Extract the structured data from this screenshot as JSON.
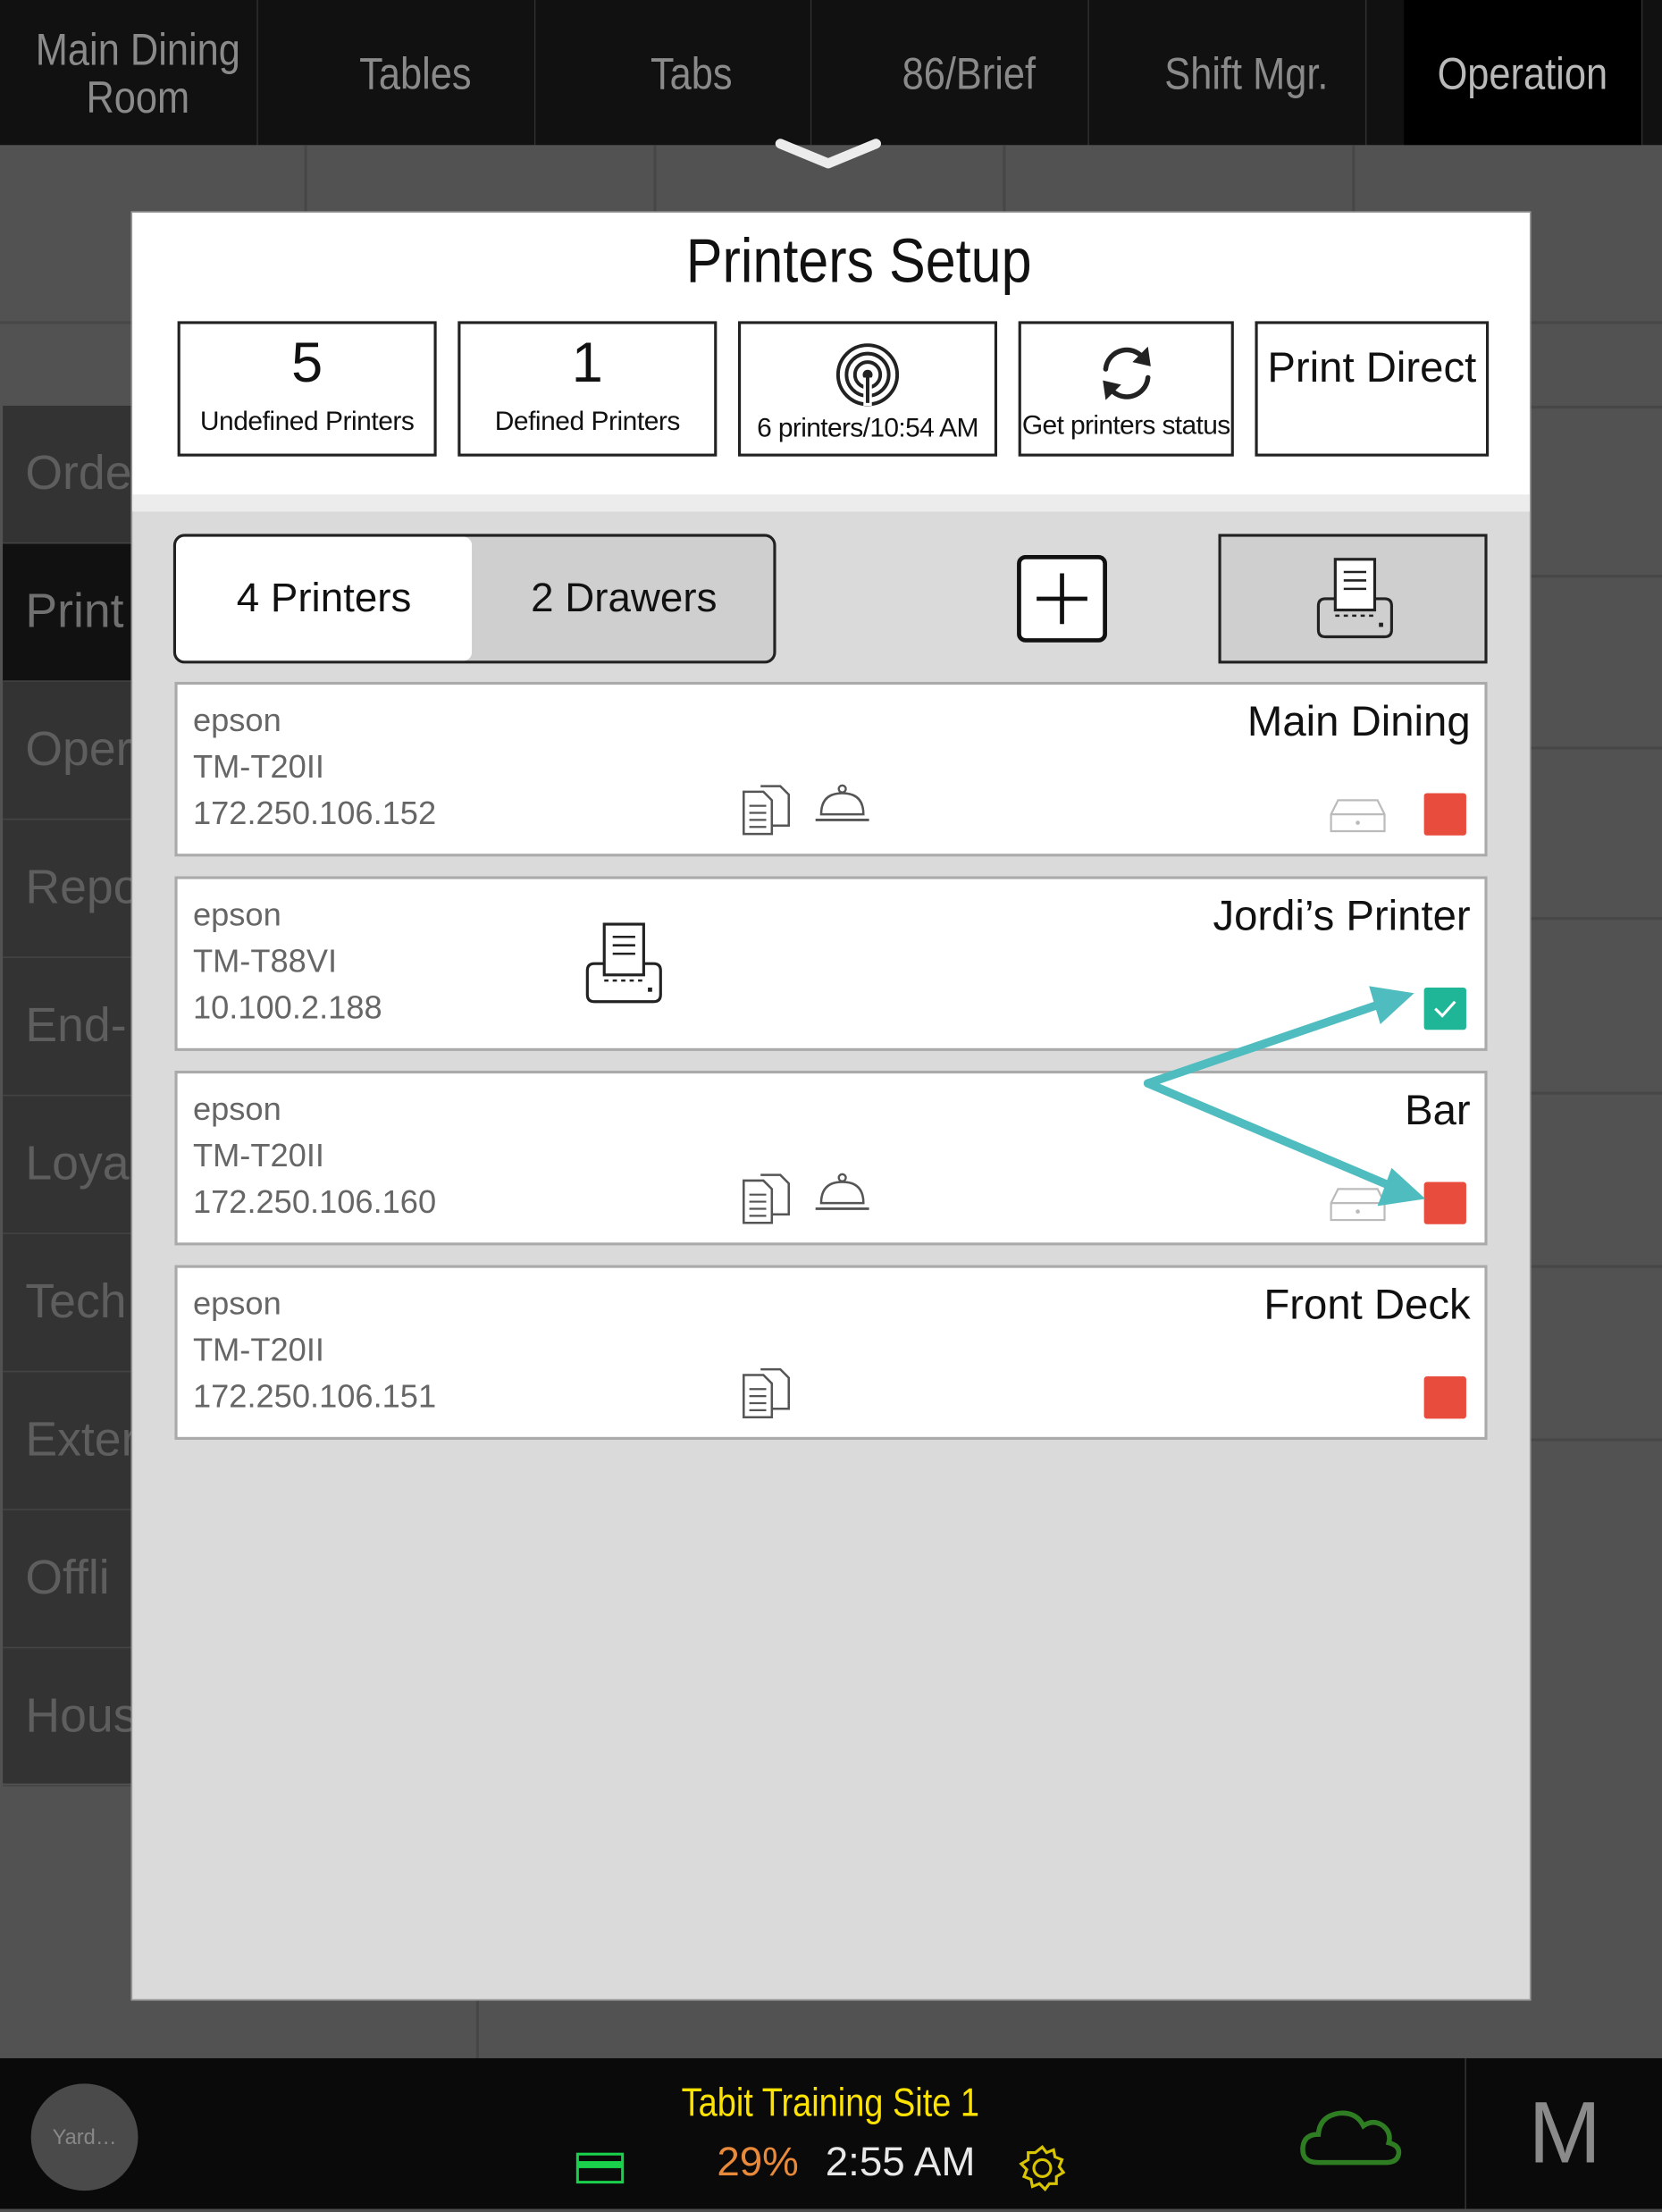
{
  "topnav": {
    "tabs": [
      {
        "label": "Main Dining Room"
      },
      {
        "label": "Tables"
      },
      {
        "label": "Tabs"
      },
      {
        "label": "86/Brief"
      },
      {
        "label": "Shift Mgr."
      },
      {
        "label": "Operation"
      }
    ],
    "active_tab": "Operation"
  },
  "sidemenu": {
    "items": [
      "Orde",
      "Print",
      "Oper",
      "Repo",
      "End-",
      "Loya",
      "Tech",
      "Exter",
      "Offli",
      "Hous"
    ],
    "active_item": "Print"
  },
  "modal": {
    "title": "Printers Setup",
    "stats": {
      "undefined_count": "5",
      "undefined_label": "Undefined Printers",
      "defined_count": "1",
      "defined_label": "Defined Printers",
      "scan_label": "6 printers/10:54 AM",
      "status_label": "Get printers status",
      "print_direct_label": "Print Direct"
    },
    "segment": {
      "printers_label": "4 Printers",
      "drawers_label": "2 Drawers",
      "selected": "4 Printers"
    },
    "printers": [
      {
        "brand": "epson",
        "model": "TM-T20II",
        "ip": "172.250.106.152",
        "name": "Main Dining",
        "status": "off",
        "icons": [
          "document-icon",
          "bell-icon",
          "drawer-icon"
        ]
      },
      {
        "brand": "epson",
        "model": "TM-T88VI",
        "ip": "10.100.2.188",
        "name": "Jordi’s Printer",
        "status": "on",
        "icons": [
          "printer-icon"
        ]
      },
      {
        "brand": "epson",
        "model": "TM-T20II",
        "ip": "172.250.106.160",
        "name": "Bar",
        "status": "off",
        "icons": [
          "document-icon",
          "bell-icon",
          "drawer-icon"
        ]
      },
      {
        "brand": "epson",
        "model": "TM-T20II",
        "ip": "172.250.106.151",
        "name": "Front Deck",
        "status": "off",
        "icons": [
          "document-icon"
        ]
      }
    ]
  },
  "bottombar": {
    "user_label": "Yard…",
    "site_name": "Tabit Training Site 1",
    "battery": "29%",
    "time": "2:55 AM",
    "profile_letter": "M"
  },
  "colors": {
    "status_off": "#e84c3d",
    "status_on": "#1fb597",
    "annotation_arrow": "#4fbcc0",
    "site_name": "#ffe300",
    "battery_text": "#e88a3a"
  }
}
